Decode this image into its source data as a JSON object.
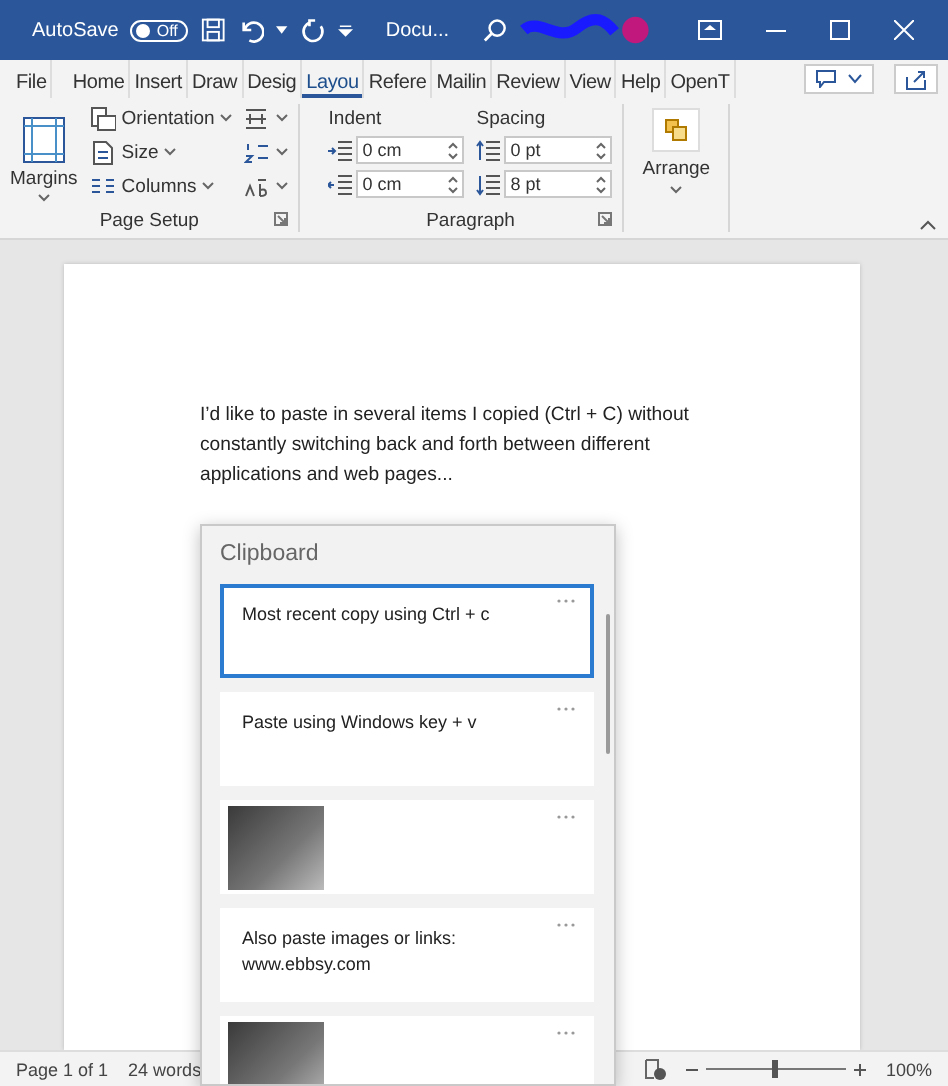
{
  "title_bar": {
    "autosave_label": "AutoSave",
    "autosave_toggle": {
      "label": "Off",
      "on": false
    },
    "document_title": "Docu..."
  },
  "ribbon_tabs": [
    {
      "label": "File",
      "selected": false
    },
    {
      "label": "Home",
      "selected": false
    },
    {
      "label": "Insert",
      "selected": false
    },
    {
      "label": "Draw",
      "selected": false
    },
    {
      "label": "Desig",
      "selected": false
    },
    {
      "label": "Layou",
      "selected": true
    },
    {
      "label": "Refere",
      "selected": false
    },
    {
      "label": "Mailin",
      "selected": false
    },
    {
      "label": "Review",
      "selected": false
    },
    {
      "label": "View",
      "selected": false
    },
    {
      "label": "Help",
      "selected": false
    },
    {
      "label": "OpenT",
      "selected": false
    }
  ],
  "page_setup": {
    "margins": "Margins",
    "orientation": "Orientation",
    "size": "Size",
    "columns": "Columns",
    "group_label": "Page Setup"
  },
  "paragraph": {
    "indent_label": "Indent",
    "spacing_label": "Spacing",
    "indent_left": "0 cm",
    "indent_right": "0 cm",
    "spacing_before": "0 pt",
    "spacing_after": "8 pt",
    "group_label": "Paragraph"
  },
  "arrange": {
    "label": "Arrange"
  },
  "document": {
    "text": "I’d like to paste in several items I copied (Ctrl + C) without constantly switching back and forth between different applications and web pages..."
  },
  "clipboard": {
    "title": "Clipboard",
    "items": [
      {
        "kind": "text",
        "text": "Most recent copy using Ctrl + c",
        "selected": true
      },
      {
        "kind": "text",
        "text": "Paste using Windows key + v",
        "selected": false
      },
      {
        "kind": "image",
        "selected": false
      },
      {
        "kind": "text",
        "text": "Also paste images or links: www.ebbsy.com",
        "selected": false
      },
      {
        "kind": "image",
        "selected": false
      }
    ]
  },
  "status_bar": {
    "page": "Page 1 of 1",
    "words": "24 words",
    "zoom": {
      "level": 0.5
    },
    "zoom_percent": "100%"
  }
}
